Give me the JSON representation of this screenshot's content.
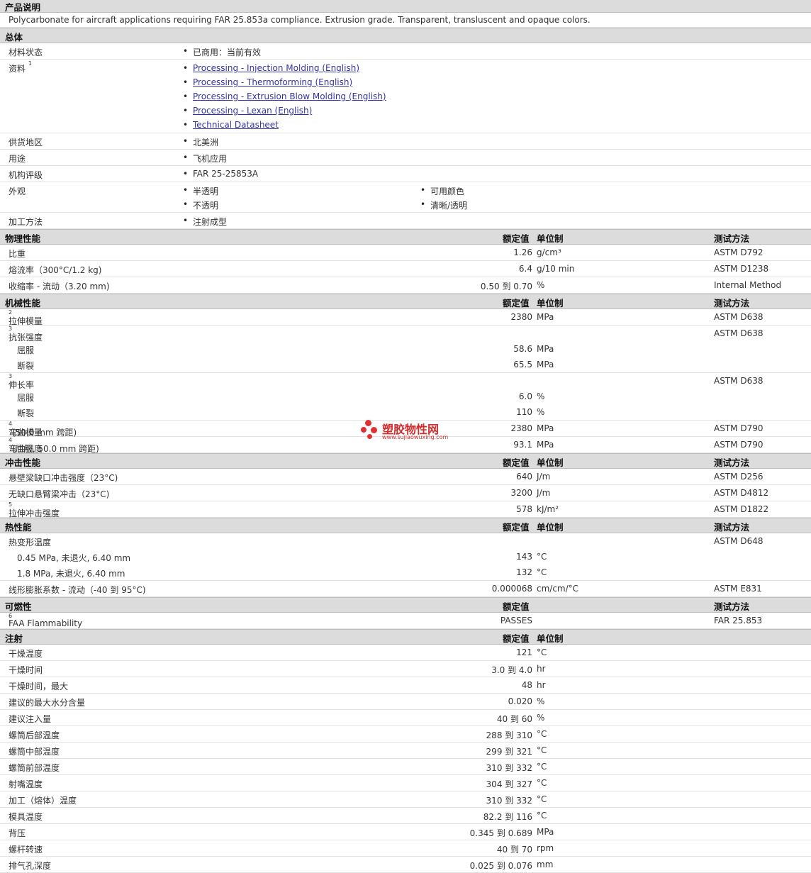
{
  "desc_header": "产品说明",
  "description": "Polycarbonate for aircraft applications requiring FAR 25.853a compliance. Extrusion grade. Transparent, transluscent and opaque colors.",
  "general": {
    "title": "总体",
    "status_label": "材料状态",
    "status_value": "已商用：当前有效",
    "docs_label": "资料",
    "docs_sup": "1",
    "docs": [
      "Processing - Injection Molding (English)",
      "Processing - Thermoforming (English)",
      "Processing - Extrusion Blow Molding (English)",
      "Processing - Lexan (English)",
      "Technical Datasheet"
    ],
    "region_label": "供货地区",
    "region_value": "北美洲",
    "use_label": "用途",
    "use_value": "飞机应用",
    "rating_label": "机构评级",
    "rating_value": "FAR 25-25853A",
    "appearance_label": "外观",
    "appearance": [
      "半透明",
      "可用颜色",
      "不透明",
      "清晰/透明"
    ],
    "process_label": "加工方法",
    "process_value": "注射成型"
  },
  "hdr": {
    "nominal": "额定值",
    "unit": "单位制",
    "method": "测试方法"
  },
  "physical": {
    "title": "物理性能",
    "rows": [
      {
        "label": "比重",
        "value": "1.26",
        "unit": "g/cm³",
        "method": "ASTM D792"
      },
      {
        "label": "熔流率（300°C/1.2 kg)",
        "value": "6.4",
        "unit": "g/10 min",
        "method": "ASTM D1238"
      },
      {
        "label": "收缩率 - 流动（3.20 mm)",
        "value": "0.50 到  0.70",
        "unit": "%",
        "method": "Internal Method"
      }
    ]
  },
  "mechanical": {
    "title": "机械性能",
    "tm_label": "拉伸模量",
    "tm_sup": "2",
    "tm_value": "2380",
    "tm_unit": "MPa",
    "tm_method": "ASTM D638",
    "ts_label": "抗张强度",
    "ts_sup": "3",
    "ts_method": "ASTM D638",
    "ts_yield_label": "屈服",
    "ts_yield_value": "58.6",
    "ts_yield_unit": "MPa",
    "ts_break_label": "断裂",
    "ts_break_value": "65.5",
    "ts_break_unit": "MPa",
    "el_label": "伸长率",
    "el_sup": "3",
    "el_method": "ASTM D638",
    "el_yield_label": "屈服",
    "el_yield_value": "6.0",
    "el_yield_unit": "%",
    "el_break_label": "断裂",
    "el_break_value": "110",
    "el_break_unit": "%",
    "fm_label": "弯曲模量",
    "fm_sup": "4",
    "fm_cond": "(50.0 mm 跨距)",
    "fm_value": "2380",
    "fm_unit": "MPa",
    "fm_method": "ASTM D790",
    "fs_label": "弯曲强度",
    "fs_sup": "4",
    "fs_cond": "(屈服, 50.0 mm 跨距)",
    "fs_value": "93.1",
    "fs_unit": "MPa",
    "fs_method": "ASTM D790"
  },
  "impact": {
    "title": "冲击性能",
    "r1_label": "悬壁梁缺口冲击强度（23°C)",
    "r1_value": "640",
    "r1_unit": "J/m",
    "r1_method": "ASTM D256",
    "r2_label": "无缺口悬臂梁冲击（23°C)",
    "r2_value": "3200",
    "r2_unit": "J/m",
    "r2_method": "ASTM D4812",
    "r3_label": "拉伸冲击强度",
    "r3_sup": "5",
    "r3_value": "578",
    "r3_unit": "kJ/m²",
    "r3_method": "ASTM D1822"
  },
  "thermal": {
    "title": "热性能",
    "hdt_label": "热变形温度",
    "hdt_method": "ASTM D648",
    "hdt1_label": "0.45 MPa, 未退火, 6.40 mm",
    "hdt1_value": "143",
    "hdt1_unit": "°C",
    "hdt2_label": "1.8 MPa, 未退火, 6.40 mm",
    "hdt2_value": "132",
    "hdt2_unit": "°C",
    "clte_label": "线形膨胀系数 - 流动（-40 到  95°C)",
    "clte_value": "0.000068",
    "clte_unit": "cm/cm/°C",
    "clte_method": "ASTM E831"
  },
  "flammability": {
    "title": "可燃性",
    "faa_label": "FAA Flammability",
    "faa_sup": "6",
    "faa_value": "PASSES",
    "faa_method": "FAR 25.853"
  },
  "injection": {
    "title": "注射",
    "rows": [
      {
        "label": "干燥温度",
        "value": "121",
        "unit": "°C"
      },
      {
        "label": "干燥时间",
        "value": "3.0 到  4.0",
        "unit": "hr"
      },
      {
        "label": "干燥时间，最大",
        "value": "48",
        "unit": "hr"
      },
      {
        "label": "建议的最大水分含量",
        "value": "0.020",
        "unit": "%"
      },
      {
        "label": "建议注入量",
        "value": "40 到  60",
        "unit": "%"
      },
      {
        "label": "螺筒后部温度",
        "value": "288 到  310",
        "unit": "°C"
      },
      {
        "label": "螺筒中部温度",
        "value": "299 到  321",
        "unit": "°C"
      },
      {
        "label": "螺筒前部温度",
        "value": "310 到  332",
        "unit": "°C"
      },
      {
        "label": "射嘴温度",
        "value": "304 到  327",
        "unit": "°C"
      },
      {
        "label": "加工（熔体）温度",
        "value": "310 到  332",
        "unit": "°C"
      },
      {
        "label": "模具温度",
        "value": "82.2 到  116",
        "unit": "°C"
      },
      {
        "label": "背压",
        "value": "0.345 到  0.689",
        "unit": "MPa"
      },
      {
        "label": "螺杆转速",
        "value": "40 到  70",
        "unit": "rpm"
      },
      {
        "label": "排气孔深度",
        "value": "0.025 到  0.076",
        "unit": "mm"
      }
    ]
  },
  "watermark": {
    "text": "塑胶物性网",
    "url": "www.sujiaowuxing.com"
  }
}
